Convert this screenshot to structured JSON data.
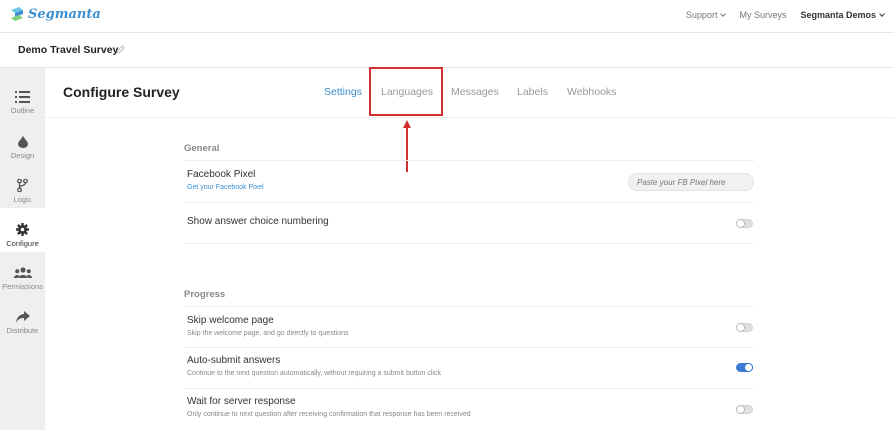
{
  "brand": {
    "name": "Segmanta",
    "color": "#3a8fd1"
  },
  "topnav": {
    "support": "Support",
    "my_surveys": "My Surveys",
    "account": "Segmanta Demos"
  },
  "survey": {
    "title": "Demo Travel Survey"
  },
  "sidebar": {
    "items": [
      {
        "label": "Outline",
        "icon": "list-icon"
      },
      {
        "label": "Design",
        "icon": "drop-icon"
      },
      {
        "label": "Logic",
        "icon": "branch-icon"
      },
      {
        "label": "Configure",
        "icon": "gear-icon",
        "active": true
      },
      {
        "label": "Permissions",
        "icon": "users-icon"
      },
      {
        "label": "Distribute",
        "icon": "share-icon"
      }
    ]
  },
  "main": {
    "title": "Configure Survey",
    "tabs": [
      {
        "label": "Settings",
        "active": true
      },
      {
        "label": "Languages"
      },
      {
        "label": "Messages"
      },
      {
        "label": "Labels"
      },
      {
        "label": "Webhooks"
      }
    ]
  },
  "general": {
    "heading": "General",
    "facebook": {
      "title": "Facebook Pixel",
      "link": "Get your Facebook Pixel",
      "placeholder": "Paste your FB Pixel here"
    },
    "numbering": {
      "title": "Show answer choice numbering",
      "enabled": false
    }
  },
  "progress": {
    "heading": "Progress",
    "items": [
      {
        "title": "Skip welcome page",
        "subtitle": "Skip the welcome page, and go directly to questions",
        "enabled": false
      },
      {
        "title": "Auto-submit answers",
        "subtitle": "Continue to the next question automatically, without requiring a submit button click",
        "enabled": true
      },
      {
        "title": "Wait for server response",
        "subtitle": "Only continue to next question after receiving confirmation that response has been received",
        "enabled": false
      }
    ]
  },
  "colors": {
    "accent": "#3a7bd5",
    "highlight": "#d0302f"
  }
}
